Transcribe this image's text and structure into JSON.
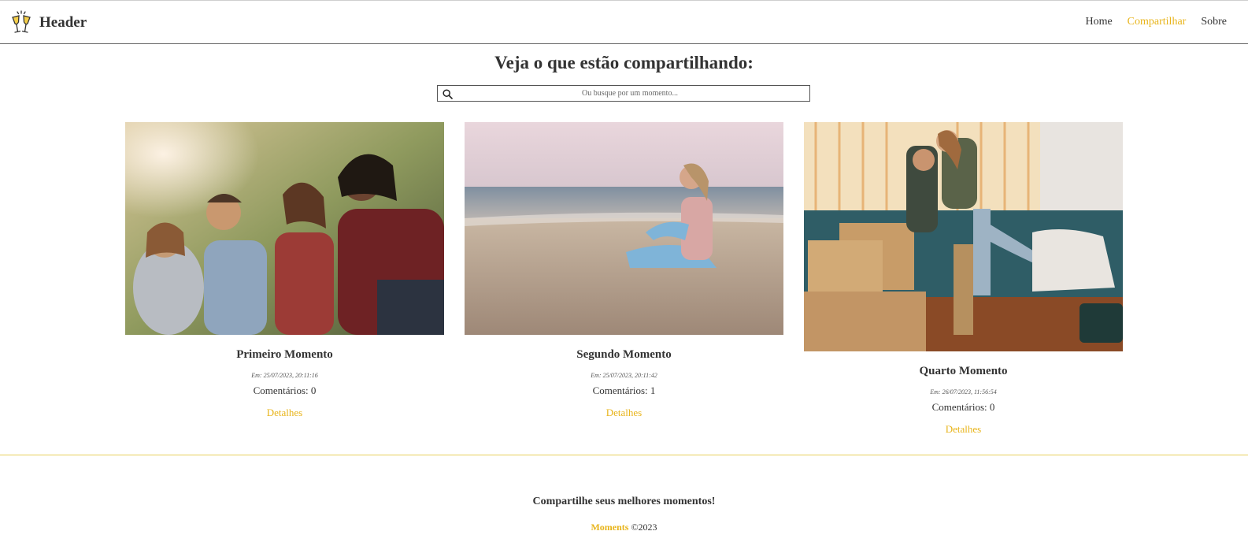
{
  "header": {
    "logo_icon": "champagne-toast-icon",
    "title": "Header",
    "nav": [
      {
        "label": "Home",
        "active": false
      },
      {
        "label": "Compartilhar",
        "active": true
      },
      {
        "label": "Sobre",
        "active": false
      }
    ]
  },
  "main": {
    "title": "Veja o que estão compartilhando:",
    "search": {
      "icon": "search-icon",
      "placeholder": "Ou busque por um momento..."
    },
    "cards": [
      {
        "title": "Primeiro Momento",
        "date": "Em: 25/07/2023, 20:11:16",
        "comments": "Comentários: 0",
        "details": "Detalhes",
        "image": "friends-laughing-outdoors-photo"
      },
      {
        "title": "Segundo Momento",
        "date": "Em: 25/07/2023, 20:11:42",
        "comments": "Comentários: 1",
        "details": "Detalhes",
        "image": "woman-sitting-on-beach-photo"
      },
      {
        "title": "Quarto Momento",
        "date": "Em: 26/07/2023, 11:56:54",
        "comments": "Comentários: 0",
        "details": "Detalhes",
        "image": "couple-hugging-moving-boxes-photo"
      }
    ]
  },
  "footer": {
    "tagline": "Compartilhe seus melhores momentos!",
    "brand": "Moments",
    "copyright": "©2023"
  },
  "colors": {
    "accent": "#e8b41a",
    "text": "#333333"
  }
}
